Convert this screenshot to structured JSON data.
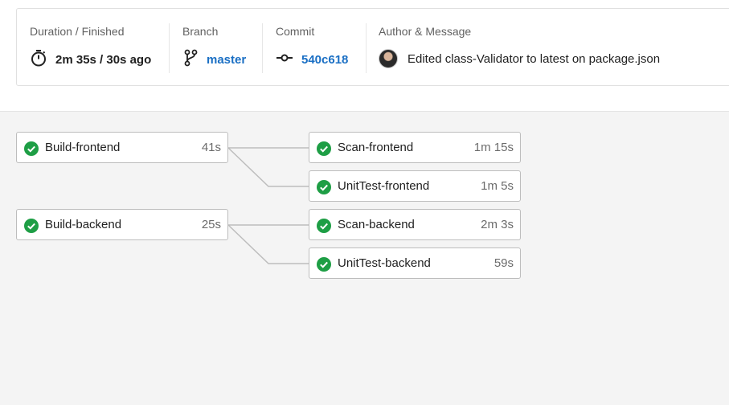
{
  "summary": {
    "duration": {
      "label": "Duration / Finished",
      "value": "2m 35s / 30s ago",
      "icon": "stopwatch-icon"
    },
    "branch": {
      "label": "Branch",
      "value": "master",
      "icon": "branch-icon"
    },
    "commit": {
      "label": "Commit",
      "value": "540c618",
      "icon": "commit-icon"
    },
    "author": {
      "label": "Author & Message",
      "message": "Edited class-Validator to latest on package.json",
      "icon": "avatar"
    }
  },
  "pipeline": {
    "status_color": "#1e9e45",
    "link_color": "#1a6fc4",
    "stages": [
      {
        "name": "Build-frontend",
        "duration": "41s",
        "status": "success"
      },
      {
        "name": "Scan-frontend",
        "duration": "1m 15s",
        "status": "success"
      },
      {
        "name": "UnitTest-frontend",
        "duration": "1m 5s",
        "status": "success"
      },
      {
        "name": "Build-backend",
        "duration": "25s",
        "status": "success"
      },
      {
        "name": "Scan-backend",
        "duration": "2m 3s",
        "status": "success"
      },
      {
        "name": "UnitTest-backend",
        "duration": "59s",
        "status": "success"
      }
    ]
  }
}
